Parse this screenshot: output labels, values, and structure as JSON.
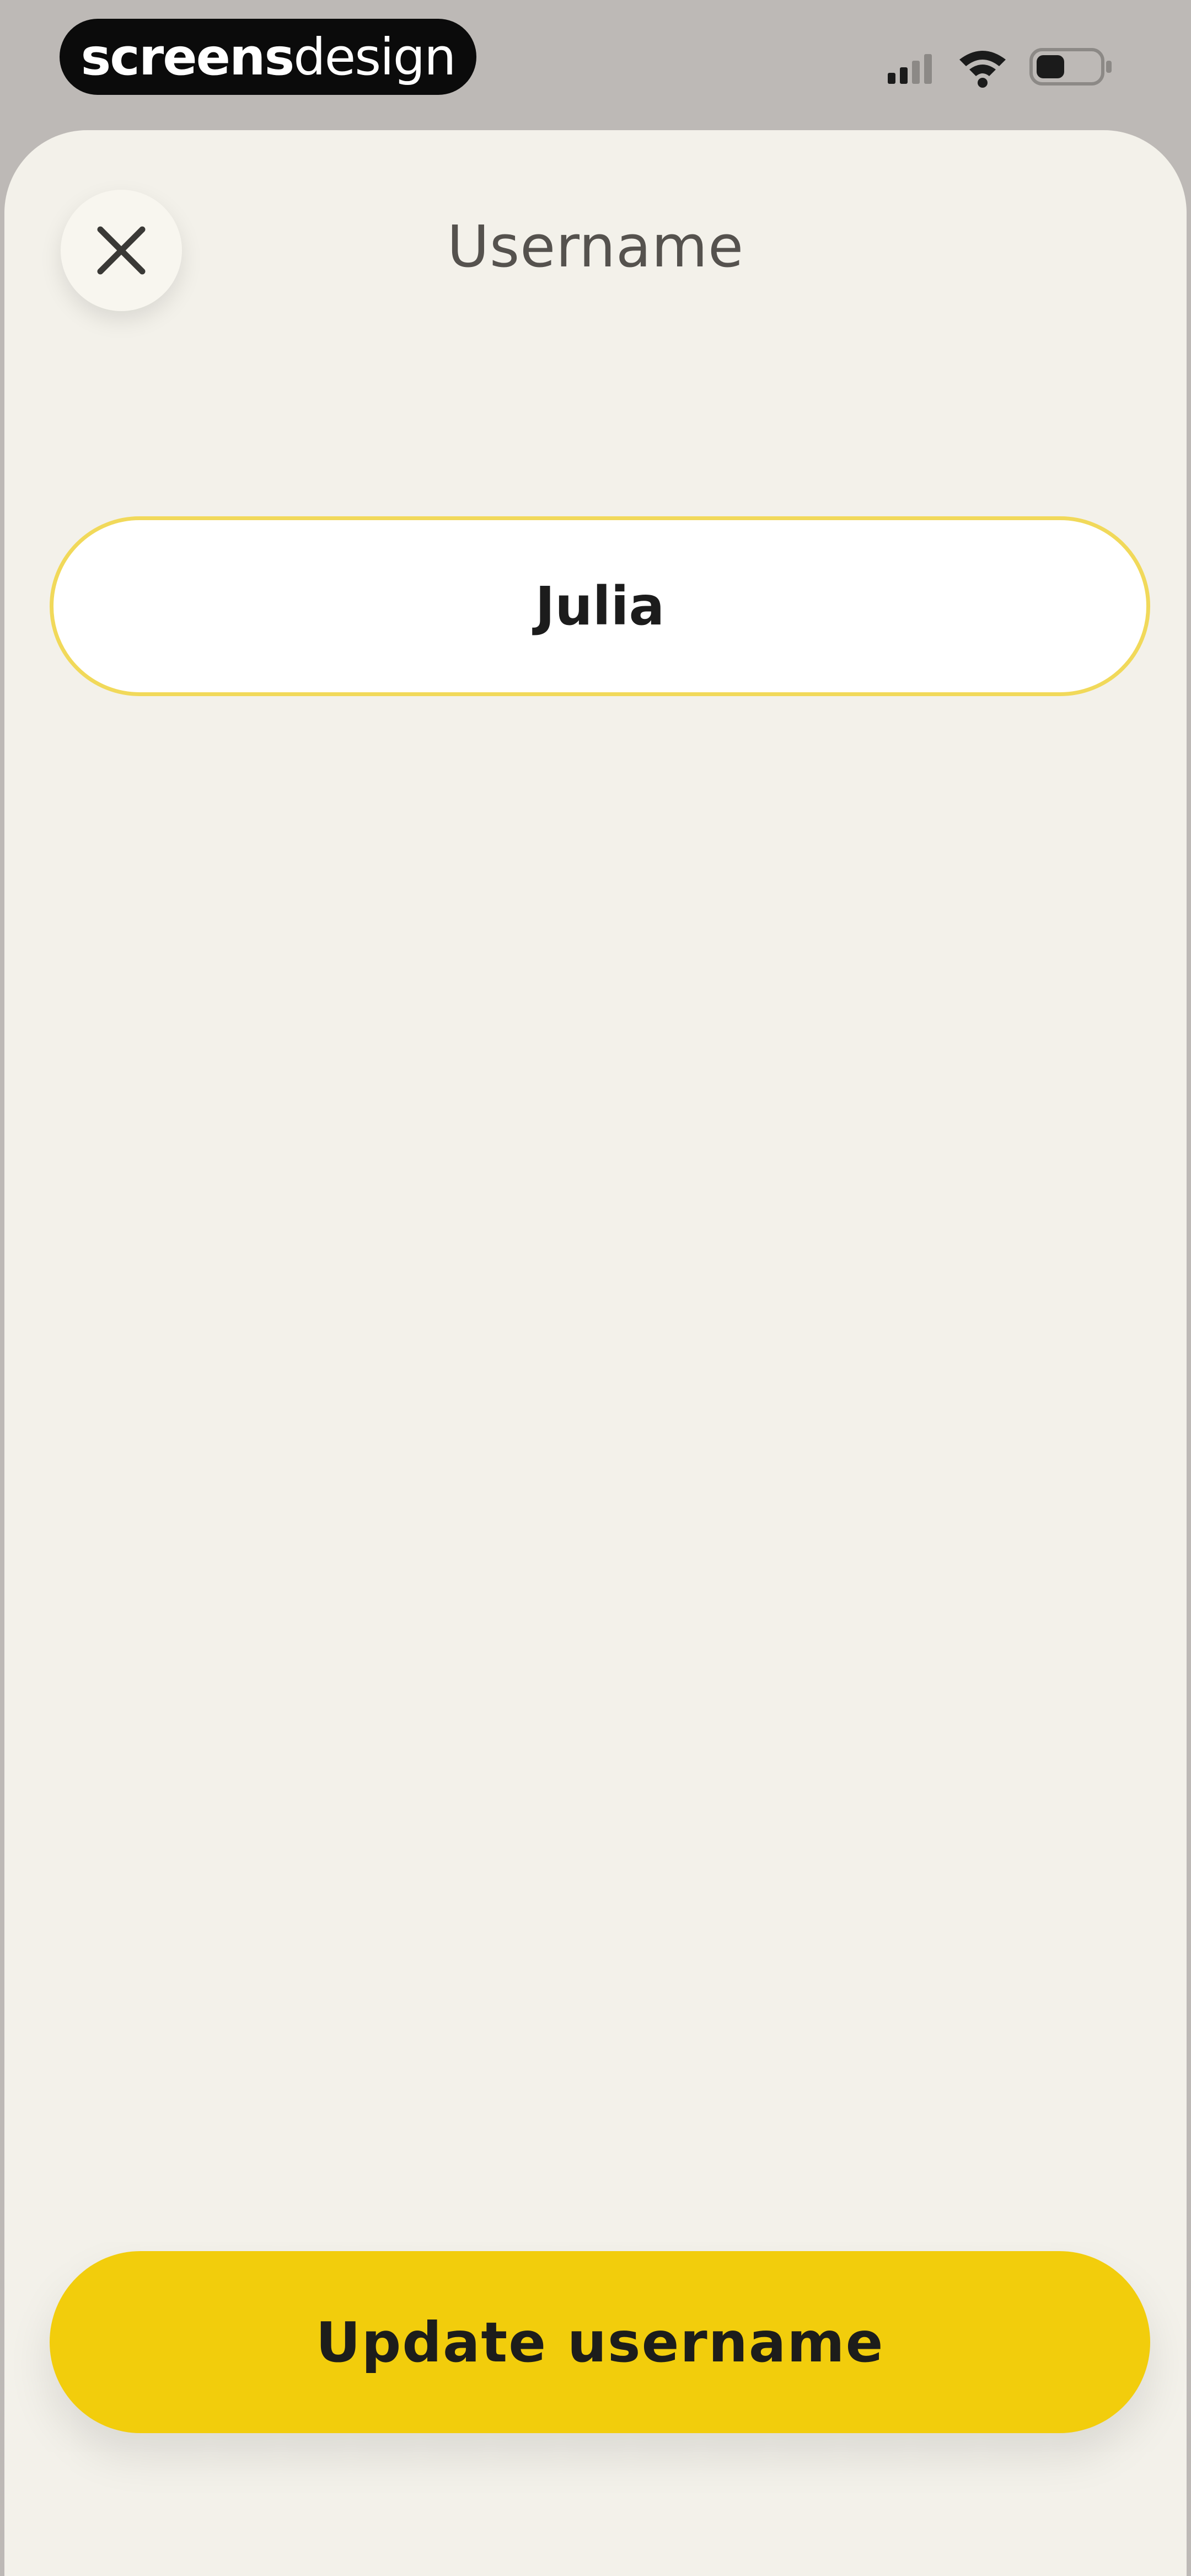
{
  "status_bar": {
    "brand_bold": "screens",
    "brand_light": "design"
  },
  "header": {
    "title": "Username"
  },
  "form": {
    "username_value": "Julia"
  },
  "actions": {
    "update_label": "Update username"
  },
  "colors": {
    "accent": "#f2cd0c",
    "field_border": "#f1d95a",
    "sheet_background": "#f3f1ea"
  }
}
